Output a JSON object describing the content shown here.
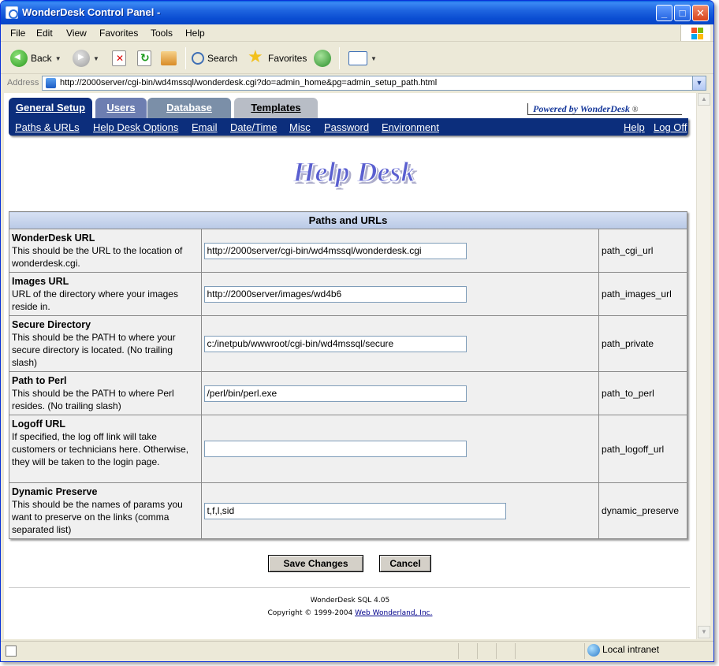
{
  "window": {
    "title": "WonderDesk Control Panel -"
  },
  "menu": [
    "File",
    "Edit",
    "View",
    "Favorites",
    "Tools",
    "Help"
  ],
  "toolbar": {
    "back": "Back",
    "search": "Search",
    "favorites": "Favorites"
  },
  "address": {
    "label": "Address",
    "url": "http://2000server/cgi-bin/wd4mssql/wonderdesk.cgi?do=admin_home&pg=admin_setup_path.html"
  },
  "tabs": [
    {
      "label": "General Setup",
      "active": true
    },
    {
      "label": "Users"
    },
    {
      "label": "Database"
    },
    {
      "label": "Templates"
    }
  ],
  "powered_by": "Powered by WonderDesk",
  "powered_mark": "®",
  "subnav": {
    "links": [
      "Paths & URLs",
      "Help Desk Options",
      "Email",
      "Date/Time",
      "Misc",
      "Password",
      "Environment"
    ],
    "right": [
      "Help",
      "Log Off"
    ]
  },
  "logo_text": "Help Desk",
  "table": {
    "header": "Paths and URLs",
    "rows": [
      {
        "title": "WonderDesk URL",
        "desc": "This should be the URL to the location of wonderdesk.cgi.",
        "value": "http://2000server/cgi-bin/wd4mssql/wonderdesk.cgi",
        "key": "path_cgi_url"
      },
      {
        "title": "Images URL",
        "desc": "URL of the directory where your images reside in.",
        "value": "http://2000server/images/wd4b6",
        "key": "path_images_url"
      },
      {
        "title": "Secure Directory",
        "desc": "This should be the PATH to where your secure directory is located. (No trailing slash)",
        "value": "c:/inetpub/wwwroot/cgi-bin/wd4mssql/secure",
        "key": "path_private"
      },
      {
        "title": "Path to Perl",
        "desc": "This should be the PATH to where Perl resides. (No trailing slash)",
        "value": "/perl/bin/perl.exe",
        "key": "path_to_perl"
      },
      {
        "title": "Logoff URL",
        "desc": "If specified, the log off link will take customers or technicians here. Otherwise, they will be taken to the login page.",
        "value": "",
        "key": "path_logoff_url"
      },
      {
        "title": "Dynamic Preserve",
        "desc": "This should be the names of params you want to preserve on the links (comma separated list)",
        "value": "t,f,l,sid",
        "key": "dynamic_preserve"
      }
    ]
  },
  "buttons": {
    "save": "Save Changes",
    "cancel": "Cancel"
  },
  "footer": {
    "version": "WonderDesk SQL 4.05",
    "copyright": "Copyright © 1999-2004",
    "link": "Web Wonderland, Inc."
  },
  "status": {
    "zone": "Local intranet"
  }
}
